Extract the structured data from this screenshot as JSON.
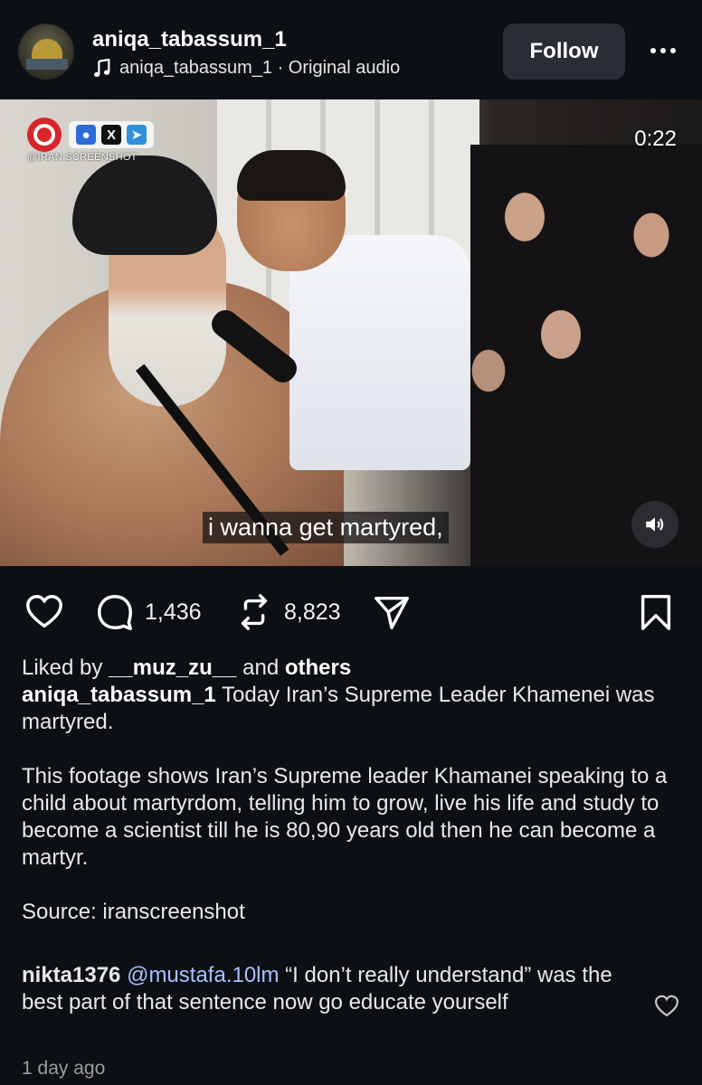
{
  "header": {
    "username": "aniqa_tabassum_1",
    "audio": "aniqa_tabassum_1 · Original audio",
    "follow_label": "Follow"
  },
  "video": {
    "time": "0:22",
    "watermark": "@IRAN.SCREENSHOT",
    "subtitle": "i wanna get martyred,",
    "social_labels": [
      "●",
      "X",
      "➤"
    ]
  },
  "actions": {
    "comments": "1,436",
    "reposts": "8,823"
  },
  "caption": {
    "liked_prefix": "Liked by ",
    "liked_user": "__muz_zu__",
    "liked_mid": " and ",
    "liked_others": "others",
    "author": "aniqa_tabassum_1",
    "text1": " Today Iran’s Supreme Leader Khamenei was martyred.",
    "text2": "This footage shows Iran’s Supreme leader Khamanei speaking to a child about martyrdom, telling him to grow, live his life and study to become a scientist till he is 80,90 years old then he can become a martyr.",
    "source": "Source: iranscreenshot"
  },
  "comment": {
    "user": "nikta1376",
    "mention": "@mustafa.10lm",
    "text": " “I don’t really understand” was the best part of that sentence now go educate yourself"
  },
  "meta": {
    "time_ago": "1 day ago"
  },
  "colors": {
    "background": "#0c0f14",
    "follow_bg": "#2a2d33",
    "mention": "#a8c1ff"
  }
}
